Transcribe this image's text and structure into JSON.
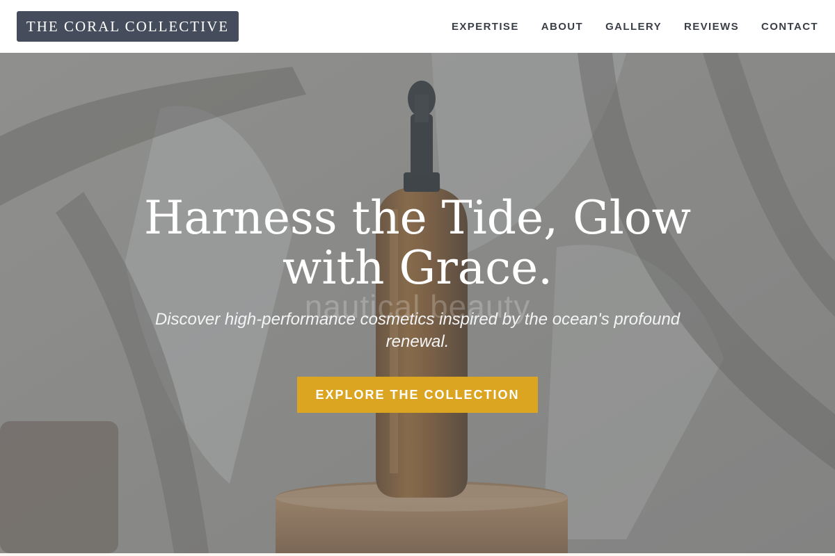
{
  "header": {
    "logo": "THE CORAL COLLECTIVE",
    "nav": [
      {
        "label": "EXPERTISE"
      },
      {
        "label": "ABOUT"
      },
      {
        "label": "GALLERY"
      },
      {
        "label": "REVIEWS"
      },
      {
        "label": "CONTACT"
      }
    ]
  },
  "hero": {
    "headline": "Harness the Tide, Glow with Grace.",
    "watermark": "nautical beauty",
    "tagline": "Discover high-performance cosmetics inspired by the ocean's profound renewal.",
    "cta_label": "EXPLORE THE COLLECTION",
    "background_image": "amber dropper bottle on wooden stand with leaf shadows"
  },
  "colors": {
    "logo_bg": "#454d5c",
    "nav_text": "#3a3f47",
    "cta_bg": "#dba522",
    "overlay": "#69767e"
  }
}
